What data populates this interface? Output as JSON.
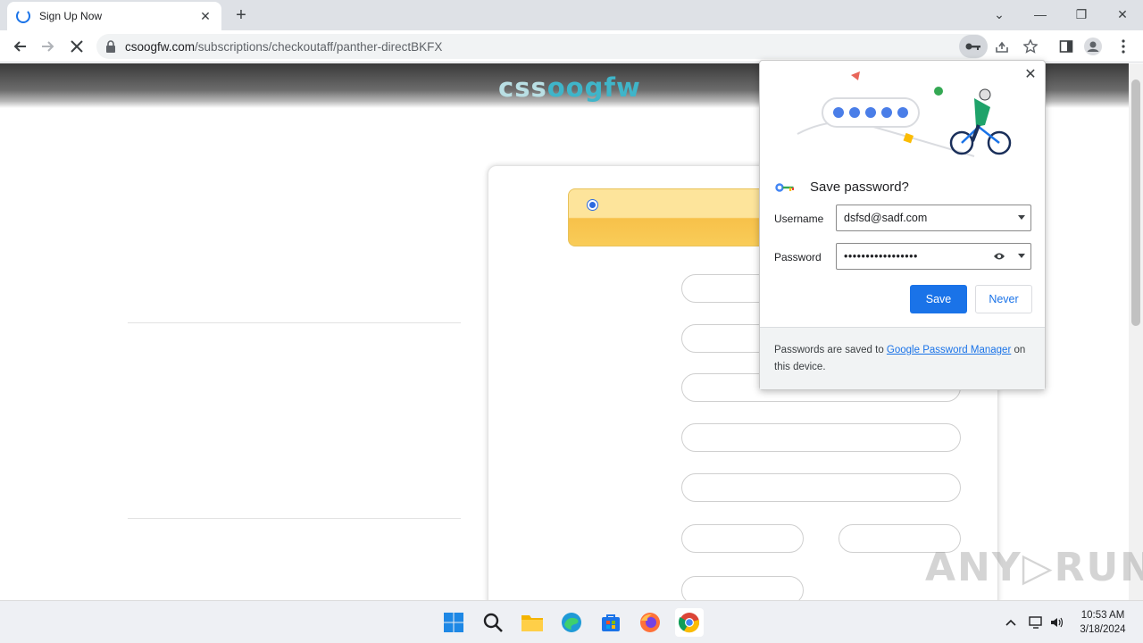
{
  "tab": {
    "title": "Sign Up Now",
    "close_glyph": "✕",
    "new_tab_glyph": "+"
  },
  "window": {
    "minimize": "—",
    "maximize": "❐",
    "close": "✕",
    "list": "⌄"
  },
  "address": {
    "host": "csoogfw.com",
    "path": "/subscriptions/checkoutaff/panther-directBKFX"
  },
  "site": {
    "logo_part1": "css",
    "logo_part2": "oogfw"
  },
  "password_bubble": {
    "title": "Save password?",
    "username_label": "Username",
    "username_value": "dsfsd@sadf.com",
    "password_label": "Password",
    "password_value": "•••••••••••••••••",
    "save_label": "Save",
    "never_label": "Never",
    "footer_prefix": "Passwords are saved to ",
    "footer_link": "Google Password Manager",
    "footer_suffix": " on this device."
  },
  "taskbar": {
    "time": "10:53 AM",
    "date": "3/18/2024"
  },
  "watermark": "ANY▷RUN",
  "colors": {
    "accent": "#1a73e8",
    "logo_light": "#b9dfe4",
    "logo_teal": "#3fb5c9",
    "plan_gold": "#f7c14a"
  }
}
